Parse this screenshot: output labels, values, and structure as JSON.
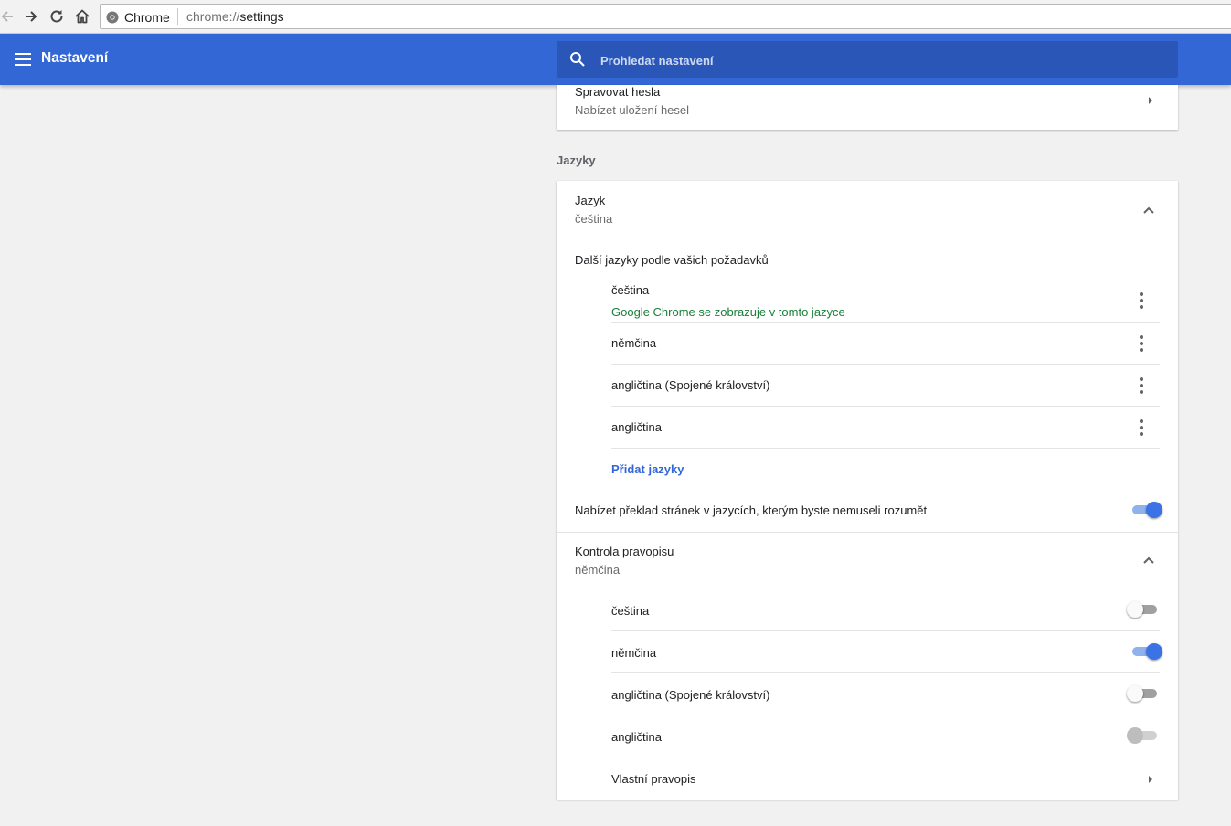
{
  "browser": {
    "site_chip": "Chrome",
    "url_scheme": "chrome://",
    "url_path": "settings",
    "icons": [
      "back-arrow-icon",
      "forward-arrow-icon",
      "reload-icon",
      "home-icon",
      "chrome-logo-icon"
    ]
  },
  "header": {
    "title": "Nastavení",
    "search_placeholder": "Prohledat nastavení",
    "color": "#3367d6"
  },
  "passwords": {
    "title": "Spravovat hesla",
    "subtitle": "Nabízet uložení hesel"
  },
  "languages": {
    "section_title": "Jazyky",
    "language": {
      "title": "Jazyk",
      "value": "čeština"
    },
    "ordering_label": "Další jazyky podle vašich požadavků",
    "list": [
      {
        "name": "čeština",
        "note": "Google Chrome se zobrazuje v tomto jazyce"
      },
      {
        "name": "němčina"
      },
      {
        "name": "angličtina (Spojené království)"
      },
      {
        "name": "angličtina"
      }
    ],
    "add_link": "Přidat jazyky",
    "translate": {
      "label": "Nabízet překlad stránek v jazycích, kterým byste nemuseli rozumět",
      "enabled": true
    },
    "spellcheck": {
      "title": "Kontrola pravopisu",
      "value": "němčina",
      "items": [
        {
          "name": "čeština",
          "enabled": false
        },
        {
          "name": "němčina",
          "enabled": true
        },
        {
          "name": "angličtina (Spojené království)",
          "enabled": false
        },
        {
          "name": "angličtina",
          "enabled": false,
          "disabled": true
        }
      ],
      "custom_label": "Vlastní pravopis"
    },
    "accent_color": "#3b73e6",
    "note_color": "#188038"
  }
}
